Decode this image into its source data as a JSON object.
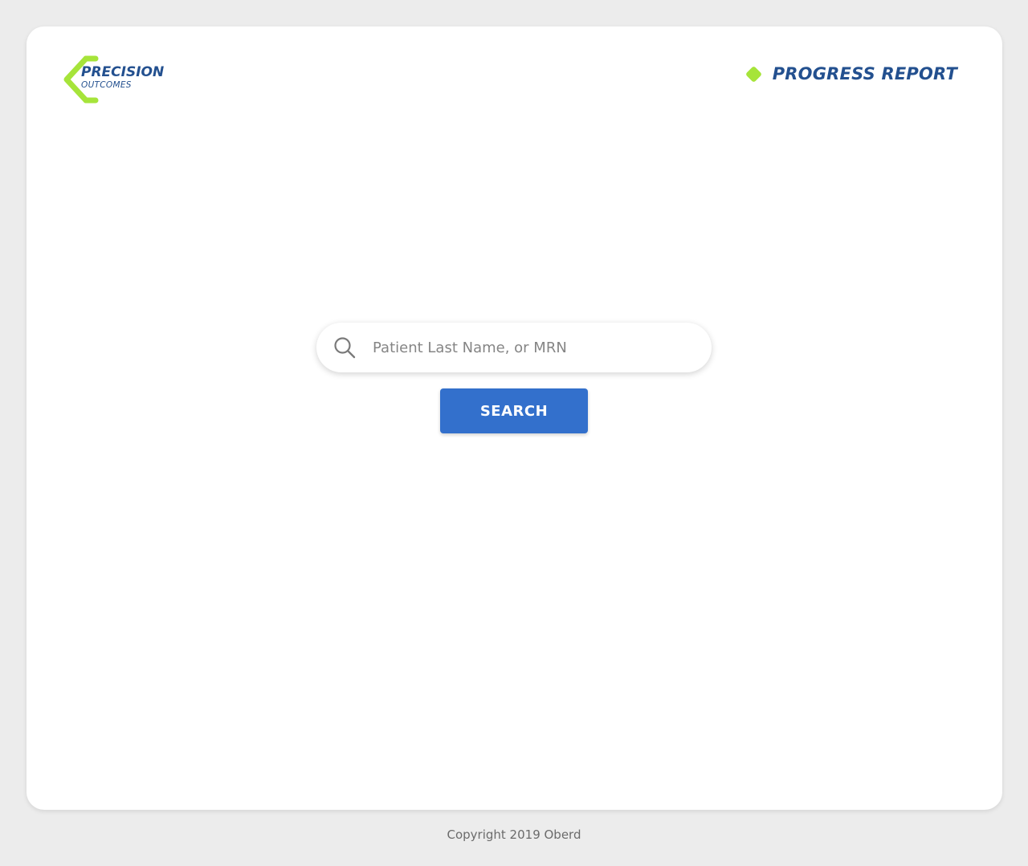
{
  "brand": {
    "logo_line1": "PRECISION",
    "logo_line2": "OUTCOMES",
    "logo_color": "#a6e43a",
    "text_color": "#23508f"
  },
  "header": {
    "title": "PROGRESS REPORT",
    "marker_icon": "green-diamond-icon"
  },
  "search": {
    "placeholder": "Patient Last Name, or MRN",
    "value": "",
    "icon": "search-icon",
    "button_label": "SEARCH",
    "button_color": "#3370cc"
  },
  "footer": {
    "copyright": "Copyright 2019 Oberd"
  }
}
